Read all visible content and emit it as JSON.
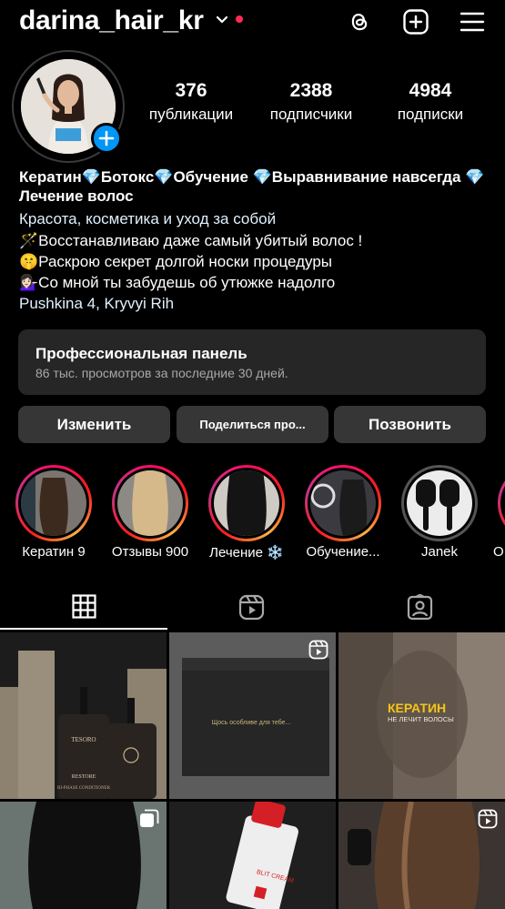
{
  "header": {
    "username": "darina_hair_kr",
    "icons": [
      "chevron-down-icon",
      "threads-icon",
      "new-post-icon",
      "menu-icon"
    ]
  },
  "profile": {
    "stats": [
      {
        "value": "376",
        "label": "публикации"
      },
      {
        "value": "2388",
        "label": "подписчики"
      },
      {
        "value": "4984",
        "label": "подписки"
      }
    ],
    "bio_title": "Кератин💎Ботокс💎Обучение 💎Выравнивание навсегда 💎Лечение волос",
    "category": "Красота, косметика и уход за собой",
    "bio_lines": [
      "🪄Восстанавливаю даже самый убитый волос !",
      "🤫Раскрою секрет долгой носки процедуры",
      "💁🏻‍♀️Со мной ты забудешь об утюжке надолго"
    ],
    "address": "Pushkina  4, Kryvyi Rih"
  },
  "panel": {
    "title": "Профессиональная панель",
    "subtitle": "86 тыс. просмотров за последние 30 дней."
  },
  "actions": {
    "edit": "Изменить",
    "share": "Поделиться про...",
    "call": "Позвонить"
  },
  "highlights": [
    {
      "label": "Кератин 9"
    },
    {
      "label": "Отзывы 900"
    },
    {
      "label": "Лечение ❄️"
    },
    {
      "label": "Обучение..."
    },
    {
      "label": "Janek"
    },
    {
      "label": "О"
    }
  ],
  "grid": {
    "post2_caption": "Щось особливе для тебе...",
    "post3_title": "КЕРАТИН",
    "post3_subtitle": "НЕ ЛЕЧИТ ВОЛОСЫ",
    "bottle_brand": "TESORO",
    "bottle_name": "RESTORE",
    "bottle_sub": "BI-PHASE CONDITIONER",
    "tube_text": "BLIT CREAM"
  },
  "colors": {
    "background": "#000000",
    "accent_blue": "#0095f6",
    "link_blue": "#e0f1ff",
    "notification_red": "#ff2d55",
    "button_bg": "#363636",
    "panel_bg": "#262626",
    "secondary_text": "#a8a8a8",
    "post3_title": "#f5c518"
  }
}
